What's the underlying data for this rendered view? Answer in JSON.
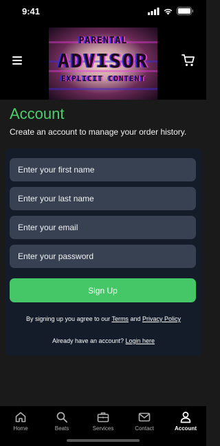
{
  "status_bar": {
    "time": "9:41",
    "icons": [
      "signal-icon",
      "wifi-icon",
      "battery-icon"
    ]
  },
  "header": {
    "menu_icon": "hamburger-menu-icon",
    "cart_icon": "cart-icon",
    "logo": {
      "line1": "PARENTAL",
      "line2": "ADVISOR",
      "line3": "EXPLICIT CONTENT"
    }
  },
  "page": {
    "title": "Account",
    "subtitle": "Create an account to manage your order history."
  },
  "form": {
    "first_name_placeholder": "Enter your first name",
    "last_name_placeholder": "Enter your last name",
    "email_placeholder": "Enter your email",
    "password_placeholder": "Enter your password",
    "signup_label": "Sign Up",
    "terms_prefix": "By signing up you agree to our ",
    "terms_link": "Terms",
    "terms_and": " and ",
    "privacy_link": "Privacy Policy",
    "login_prefix": "Already have an account? ",
    "login_link": "Login here"
  },
  "bottom_nav": {
    "items": [
      {
        "label": "Home",
        "icon": "home-icon"
      },
      {
        "label": "Beats",
        "icon": "search-icon"
      },
      {
        "label": "Services",
        "icon": "briefcase-icon"
      },
      {
        "label": "Contact",
        "icon": "mail-icon"
      },
      {
        "label": "Account",
        "icon": "user-icon",
        "active": true
      }
    ]
  },
  "colors": {
    "accent_green": "#45c767",
    "title_green": "#4cce6c",
    "card_bg": "#141c29",
    "field_bg": "#374151"
  }
}
